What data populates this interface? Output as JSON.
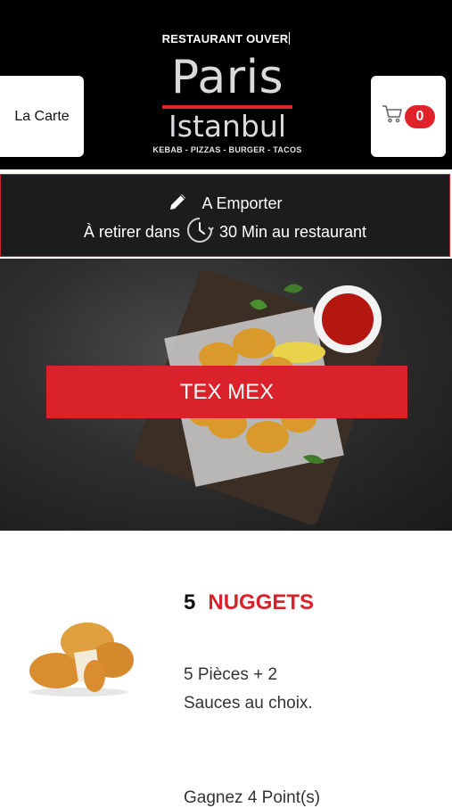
{
  "header": {
    "status": "RESTAURANT OUVER",
    "carte_label": "La Carte",
    "cart_count": "0",
    "logo": {
      "line1": "Paris",
      "line2": "Istanbul",
      "tagline": "KEBAB - PIZZAS - BURGER - TACOS"
    }
  },
  "pickup": {
    "mode": "A Emporter",
    "prefix": "À retirer dans",
    "time": "30 Min au restaurant"
  },
  "hero": {
    "category": "TEX MEX"
  },
  "product": {
    "quantity": "5",
    "name": "NUGGETS",
    "description_line1": "5 Pièces  + 2",
    "description_line2": "Sauces au choix.",
    "next_text": "Gagnez 4 Point(s)"
  },
  "colors": {
    "accent": "#d9222a",
    "header_bg": "#000000",
    "banner_bg": "#1c1c1c"
  }
}
